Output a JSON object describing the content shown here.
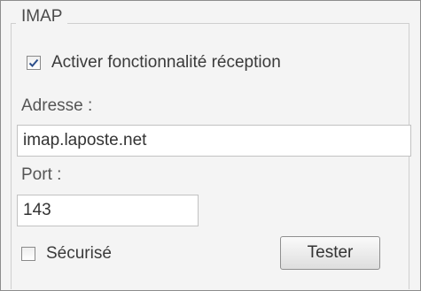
{
  "imap": {
    "title": "IMAP",
    "enable_reception": {
      "label": "Activer fonctionnalité réception",
      "checked": true
    },
    "address": {
      "label": "Adresse :",
      "value": "imap.laposte.net"
    },
    "port": {
      "label": "Port :",
      "value": "143"
    },
    "secure": {
      "label": "Sécurisé",
      "checked": false
    },
    "test_button": {
      "label": "Tester"
    }
  },
  "colors": {
    "checkmark": "#2d4f8c",
    "border": "#c2c2c2",
    "background": "#f4f4f4"
  },
  "icons": {
    "checked": "checkmark-icon"
  }
}
